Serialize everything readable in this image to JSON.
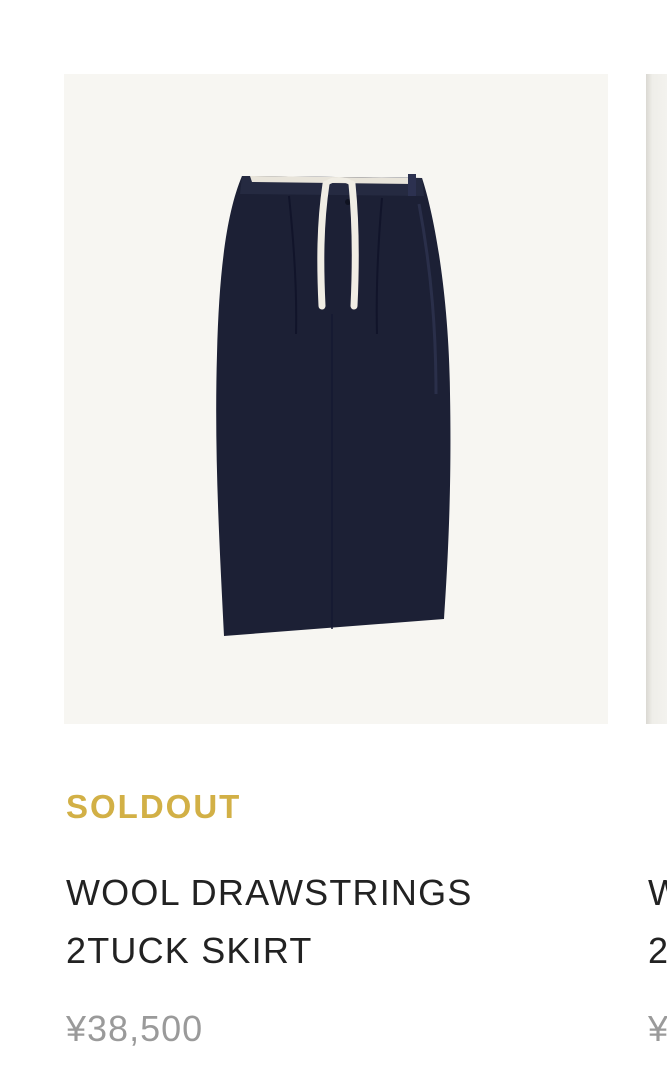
{
  "products": [
    {
      "status": "SOLDOUT",
      "name": "WOOL DRAWSTRINGS 2TUCK SKIRT",
      "price": "¥38,500",
      "image_alt": "navy wool skirt with white drawstrings",
      "favorite_icon": "heart-icon",
      "favorited": false
    },
    {
      "name_line1_partial": "W",
      "name_line2_partial": "2",
      "price_partial": "¥"
    }
  ],
  "colors": {
    "status": "#d2b046",
    "name": "#222222",
    "price": "#9a9a9a",
    "heart": "#9e9e9e",
    "skirt": "#1c2035",
    "drawstring": "#f0ede4",
    "image_bg": "#f7f6f2"
  }
}
